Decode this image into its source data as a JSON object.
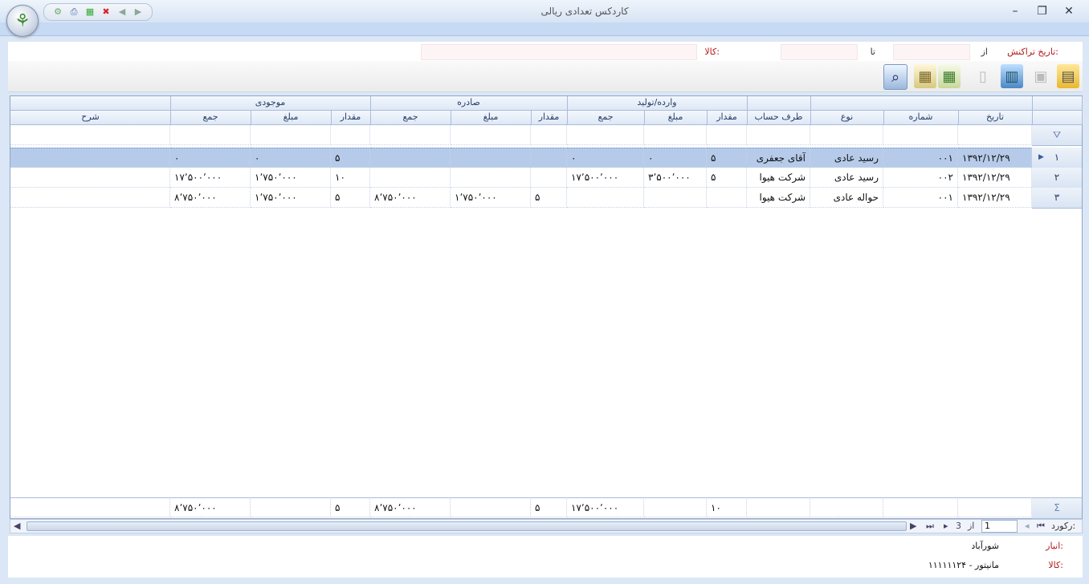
{
  "window": {
    "title": "کاردکس تعدادی ریالی",
    "minimize": "–",
    "maximize": "❐",
    "close": "✕"
  },
  "filter": {
    "date_label": "تاریخ تراکنش:",
    "from_label": "از",
    "from_value": "",
    "to_label": "تا",
    "to_value": "",
    "item_label": "کالا:",
    "item_value": ""
  },
  "grid": {
    "bands": {
      "empty": "",
      "incoming": "وارده/تولید",
      "outgoing": "صادره",
      "balance": "موجودی"
    },
    "columns": {
      "date": "تاریخ",
      "number": "شماره",
      "type": "نوع",
      "party": "طرف حساب",
      "in_qty": "مقدار",
      "in_price": "مبلغ",
      "in_total": "جمع",
      "out_qty": "مقدار",
      "out_price": "مبلغ",
      "out_total": "جمع",
      "bal_qty": "مقدار",
      "bal_price": "مبلغ",
      "bal_total": "جمع",
      "desc": "شرح"
    },
    "rows": [
      {
        "idx": "۱",
        "date": "۱۳۹۲/۱۲/۲۹",
        "number": "۰۰۱",
        "type": "رسید عادی",
        "party": "آقای جعفری",
        "in_qty": "۵",
        "in_price": "۰",
        "in_total": "۰",
        "out_qty": "",
        "out_price": "",
        "out_total": "",
        "bal_qty": "۵",
        "bal_price": "۰",
        "bal_total": "۰",
        "desc": ""
      },
      {
        "idx": "۲",
        "date": "۱۳۹۲/۱۲/۲۹",
        "number": "۰۰۲",
        "type": "رسید عادی",
        "party": "شرکت هیوا",
        "in_qty": "۵",
        "in_price": "۳٬۵۰۰٬۰۰۰",
        "in_total": "۱۷٬۵۰۰٬۰۰۰",
        "out_qty": "",
        "out_price": "",
        "out_total": "",
        "bal_qty": "۱۰",
        "bal_price": "۱٬۷۵۰٬۰۰۰",
        "bal_total": "۱۷٬۵۰۰٬۰۰۰",
        "desc": ""
      },
      {
        "idx": "۳",
        "date": "۱۳۹۲/۱۲/۲۹",
        "number": "۰۰۱",
        "type": "حواله عادی",
        "party": "شرکت هیوا",
        "in_qty": "",
        "in_price": "",
        "in_total": "",
        "out_qty": "۵",
        "out_price": "۱٬۷۵۰٬۰۰۰",
        "out_total": "۸٬۷۵۰٬۰۰۰",
        "bal_qty": "۵",
        "bal_price": "۱٬۷۵۰٬۰۰۰",
        "bal_total": "۸٬۷۵۰٬۰۰۰",
        "desc": ""
      }
    ],
    "footer": {
      "in_qty": "۱۰",
      "in_total": "۱۷٬۵۰۰٬۰۰۰",
      "out_qty": "۵",
      "out_total": "۸٬۷۵۰٬۰۰۰",
      "bal_qty": "۵",
      "bal_total": "۸٬۷۵۰٬۰۰۰"
    },
    "indicator": {
      "filter_icon": "filter-icon",
      "sum_icon": "sigma-icon",
      "row_pointer": "▶"
    }
  },
  "nav": {
    "record_label": "رکورد:",
    "current": "1",
    "of_label": "از",
    "total": "3"
  },
  "bottom": {
    "warehouse_label": "انبار:",
    "warehouse_value": "شورآباد",
    "item_label": "کالا:",
    "item_value": "۱۱۱۱۱۱۲۴ - مانیتور"
  },
  "colors": {
    "label_red": "#b01818",
    "selected_row": "#b6cbe9",
    "header_text": "#2a3e66"
  }
}
